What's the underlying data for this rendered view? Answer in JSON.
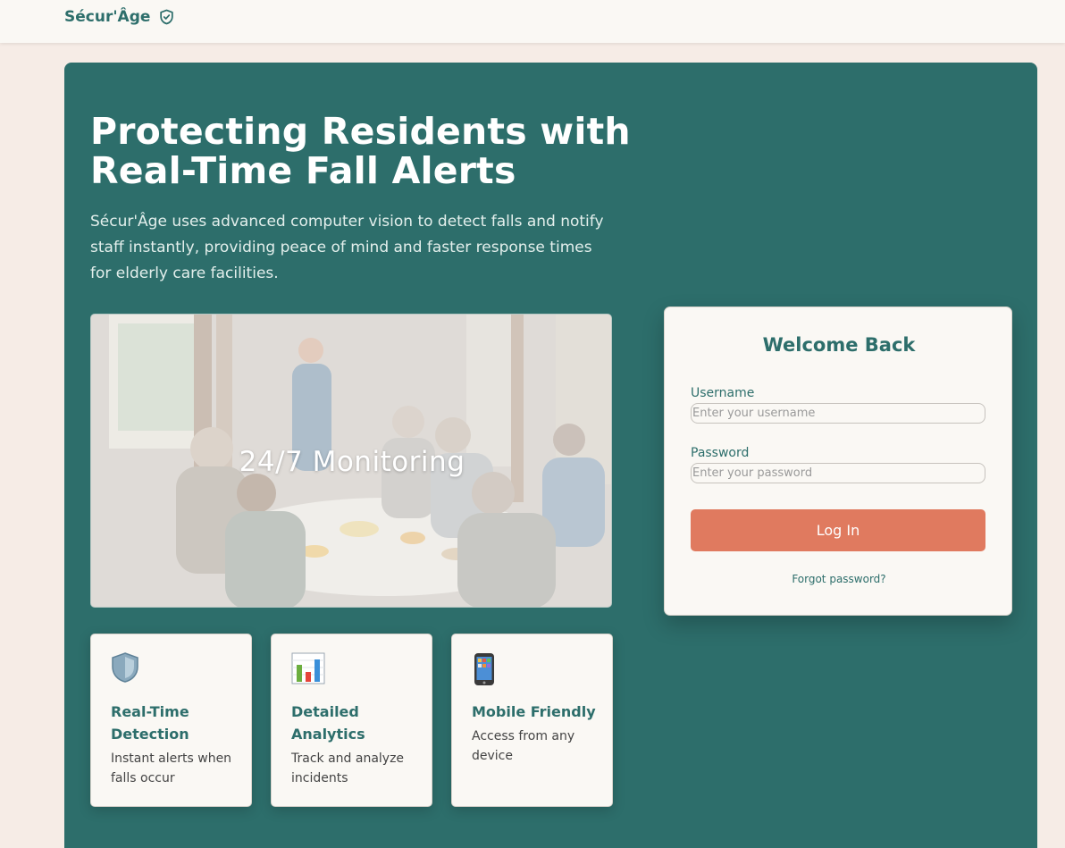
{
  "brand": {
    "name": "Sécur'Âge",
    "icon": "shield-check-icon"
  },
  "hero": {
    "headline_line1": "Protecting Residents with",
    "headline_line2": "Real-Time Fall Alerts",
    "tagline": "Sécur'Âge uses advanced computer vision to detect falls and notify staff instantly, providing peace of mind and faster response times for elderly care facilities.",
    "photo_caption": "24/7 Monitoring"
  },
  "features": [
    {
      "icon": "shield-icon",
      "glyph": "🛡️",
      "title": "Real-Time Detection",
      "description": "Instant alerts when falls occur"
    },
    {
      "icon": "bar-chart-icon",
      "glyph": "📊",
      "title": "Detailed Analytics",
      "description": "Track and analyze incidents"
    },
    {
      "icon": "mobile-phone-icon",
      "glyph": "📱",
      "title": "Mobile Friendly",
      "description": "Access from any device"
    }
  ],
  "login": {
    "title": "Welcome Back",
    "username_label": "Username",
    "username_placeholder": "Enter your username",
    "password_label": "Password",
    "password_placeholder": "Enter your password",
    "submit_label": "Log In",
    "forgot_label": "Forgot password?"
  },
  "colors": {
    "primary": "#2d6e6b",
    "accent": "#e07a5f",
    "page_background": "#f6ece6",
    "card_background": "#faf8f4"
  }
}
